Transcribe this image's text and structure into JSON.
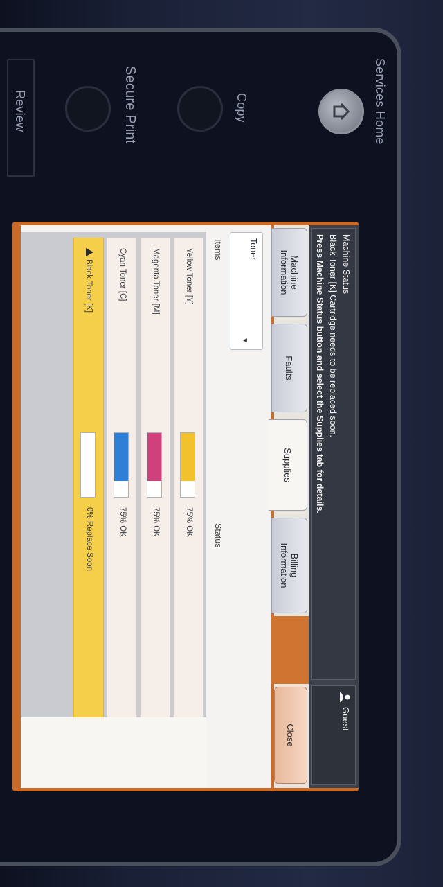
{
  "hardware": {
    "services_home": "Services Home",
    "copy": "Copy",
    "secure_print": "Secure Print",
    "review": "Review"
  },
  "header": {
    "title": "Machine Status",
    "line1": "Black Toner [K] Cartridge needs to be replaced soon.",
    "line2": "Press Machine Status button and select the Supplies tab for details.",
    "user": "Guest"
  },
  "tabs": [
    {
      "label": "Machine\nInformation"
    },
    {
      "label": "Faults"
    },
    {
      "label": "Supplies"
    },
    {
      "label": "Billing\nInformation"
    }
  ],
  "close_label": "Close",
  "filter": {
    "selected": "Toner"
  },
  "columns": {
    "items": "Items",
    "status": "Status"
  },
  "supplies": [
    {
      "name": "Yellow Toner [Y]",
      "level": 0.75,
      "status": "75% OK",
      "color": "#f2c12e"
    },
    {
      "name": "Magenta Toner [M]",
      "level": 0.75,
      "status": "75% OK",
      "color": "#d0407a"
    },
    {
      "name": "Cyan Toner [C]",
      "level": 0.75,
      "status": "75% OK",
      "color": "#2f7fd6"
    },
    {
      "name": "Black Toner [K]",
      "level": 0.0,
      "status": "0% Replace Soon",
      "color": "#222222"
    }
  ],
  "accent": "#c86a28"
}
